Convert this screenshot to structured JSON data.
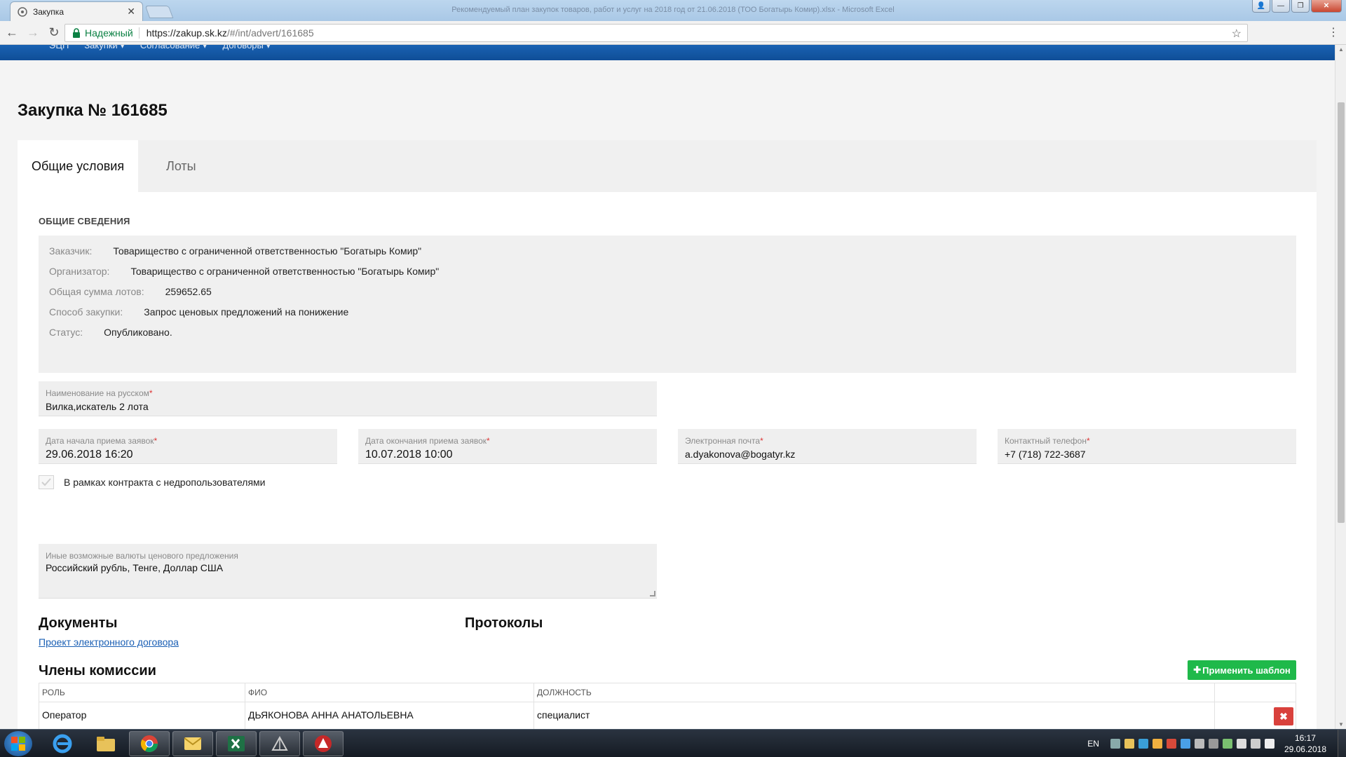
{
  "browser": {
    "tab_title": "Закупка",
    "window_caption": "Рекомендуемый план закупок товаров, работ и услуг на 2018 год от 21.06.2018 (ТОО Богатырь Комир).xlsx - Microsoft Excel",
    "security_label": "Надежный",
    "url_host": "https://zakup.sk.kz",
    "url_path": "/#/int/advert/161685"
  },
  "site_nav": {
    "items": [
      "ЭЦП",
      "Закупки ▾",
      "Согласование ▾",
      "Договоры ▾"
    ]
  },
  "page": {
    "title": "Закупка № 161685",
    "tabs": [
      {
        "label": "Общие условия",
        "active": true
      },
      {
        "label": "Лоты",
        "active": false
      }
    ]
  },
  "general": {
    "section_title": "ОБЩИЕ СВЕДЕНИЯ",
    "rows": [
      {
        "key": "Заказчик:",
        "value": "Товарищество с ограниченной ответственностью \"Богатырь Комир\""
      },
      {
        "key": "Организатор:",
        "value": "Товарищество с ограниченной ответственностью \"Богатырь Комир\""
      },
      {
        "key": "Общая сумма лотов:",
        "value": "259652.65"
      },
      {
        "key": "Способ закупки:",
        "value": "Запрос ценовых предложений на понижение"
      },
      {
        "key": "Статус:",
        "value": "Опубликовано."
      }
    ]
  },
  "form": {
    "name_ru": {
      "label": "Наименование на русском",
      "value": "Вилка,искатель 2 лота"
    },
    "start_date": {
      "label": "Дата начала приема заявок",
      "value": "29.06.2018 16:20"
    },
    "end_date": {
      "label": "Дата окончания приема заявок",
      "value": "10.07.2018 10:00"
    },
    "email": {
      "label": "Электронная почта",
      "value": "a.dyakonova@bogatyr.kz"
    },
    "phone": {
      "label": "Контактный телефон",
      "value": "+7 (718) 722-3687"
    },
    "required_mark": "*",
    "subsoil_checkbox": {
      "label": "В рамках контракта с недропользователями",
      "checked": true
    },
    "currencies": {
      "label": "Иные возможные валюты ценового предложения",
      "value": "Российский  рубль, Тенге, Доллар США"
    }
  },
  "documents": {
    "title": "Документы",
    "link": "Проект электронного договора"
  },
  "protocols": {
    "title": "Протоколы"
  },
  "commission": {
    "title": "Члены комиссии",
    "apply_button": "Применить шаблон",
    "columns": [
      "РОЛЬ",
      "ФИО",
      "ДОЛЖНОСТЬ",
      ""
    ],
    "rows": [
      {
        "role": "Оператор",
        "name": "ДЬЯКОНОВА АННА АНАТОЛЬЕВНА",
        "position": "специалист"
      }
    ]
  },
  "taskbar": {
    "lang": "EN",
    "time": "16:17",
    "date": "29.06.2018"
  },
  "colors": {
    "header_blue": "#1a62b3",
    "accent_green": "#1fb94a",
    "danger_red": "#d9413c",
    "link_blue": "#1a5fb4",
    "secure_green": "#0b8043"
  }
}
